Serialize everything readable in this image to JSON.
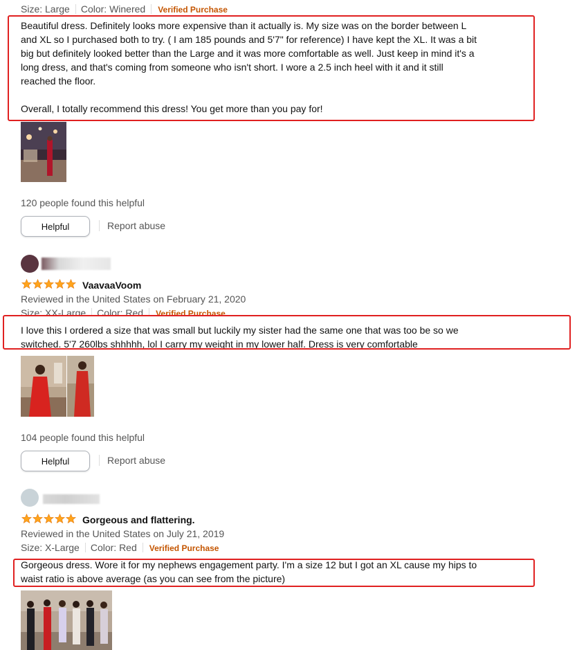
{
  "review1": {
    "meta": {
      "size": "Size: Large",
      "color": "Color: Winered",
      "verified": "Verified Purchase"
    },
    "body": [
      "Beautiful dress. Definitely looks more expensive than it actually is. My size was on the border between L",
      "and XL so I purchased both to try. ( I am 185 pounds and 5'7\" for reference) I have kept the XL. It was a bit",
      "big but definitely looked better than the Large and it was more comfortable as well. Just keep in mind it's a",
      "long dress, and that's coming from someone who isn't short. I wore a 2.5 inch heel with it and it still",
      "reached the floor.",
      "",
      "Overall, I totally recommend this dress! You get more than you pay for!"
    ],
    "helpful_count": "120 people found this helpful",
    "helpful_label": "Helpful",
    "report_label": "Report abuse"
  },
  "review2": {
    "name": "VaavaaVoom",
    "rating": 5,
    "reviewed": "Reviewed in the United States on February 21, 2020",
    "meta": {
      "size": "Size: XX-Large",
      "color": "Color: Red",
      "verified": "Verified Purchase"
    },
    "body": [
      "I love this I ordered a size that was small but luckily my sister had the same one that was too be so we",
      "switched. 5'7 260lbs shhhhh, lol I carry my weight in my lower half. Dress is very comfortable"
    ],
    "helpful_count": "104 people found this helpful",
    "helpful_label": "Helpful",
    "report_label": "Report abuse"
  },
  "review3": {
    "rating": 5,
    "title": "Gorgeous and flattering.",
    "reviewed": "Reviewed in the United States on July 21, 2019",
    "meta": {
      "size": "Size: X-Large",
      "color": "Color: Red",
      "verified": "Verified Purchase"
    },
    "body": [
      "Gorgeous dress. Wore it for my nephews engagement party. I'm a size 12 but I got an XL cause my hips to",
      "waist ratio is above average (as you can see from the picture)"
    ]
  },
  "colors": {
    "star": "#ffa41c",
    "verified": "#c45500",
    "highlight": "#e02020",
    "muted": "#555555"
  },
  "icons": {
    "star": "star-icon",
    "avatar": "avatar"
  }
}
